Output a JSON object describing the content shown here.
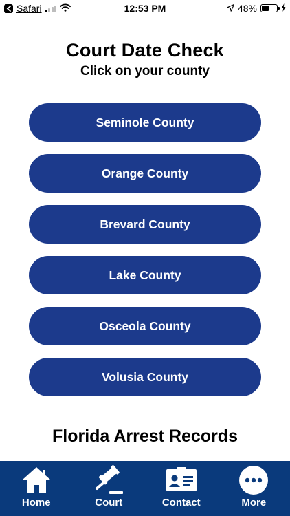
{
  "status_bar": {
    "back_app": "Safari",
    "time": "12:53 PM",
    "battery": "48%",
    "battery_level": 0.48
  },
  "header": {
    "title": "Court Date Check",
    "subtitle": "Click on your county"
  },
  "counties": [
    {
      "label": "Seminole County"
    },
    {
      "label": "Orange County"
    },
    {
      "label": "Brevard County"
    },
    {
      "label": "Lake County"
    },
    {
      "label": "Osceola County"
    },
    {
      "label": "Volusia County"
    }
  ],
  "section": {
    "title": "Florida Arrest Records"
  },
  "tab_bar": {
    "active_tab": "Court",
    "items": [
      {
        "label": "Home",
        "icon": "home-icon"
      },
      {
        "label": "Court",
        "icon": "gavel-icon"
      },
      {
        "label": "Contact",
        "icon": "contact-card-icon"
      },
      {
        "label": "More",
        "icon": "more-icon"
      }
    ]
  },
  "colors": {
    "button": "#1c3a8c",
    "tab_bar": "#0a3a7c"
  }
}
